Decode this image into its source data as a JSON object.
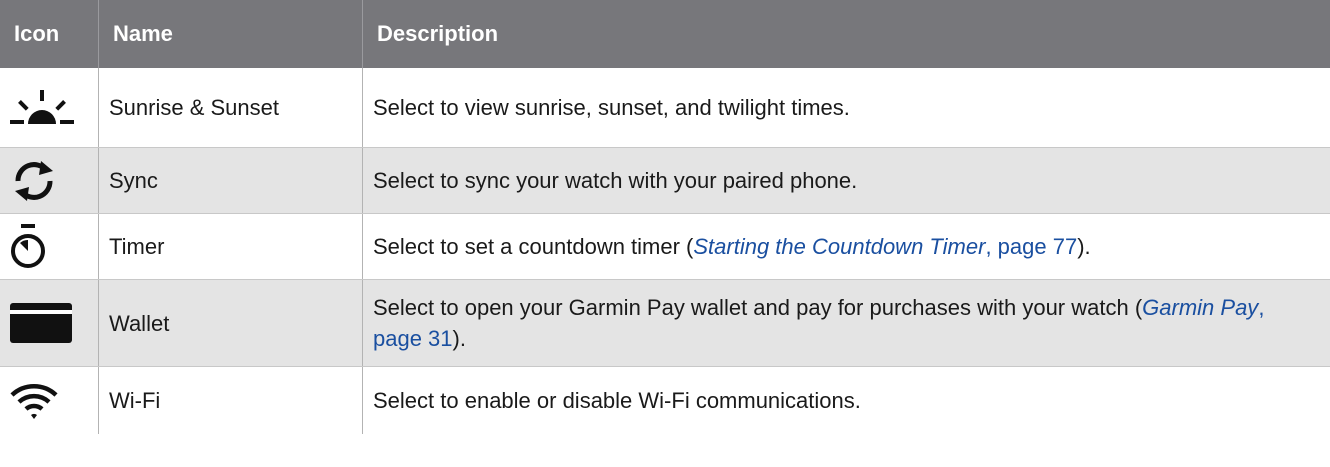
{
  "header": {
    "icon": "Icon",
    "name": "Name",
    "description": "Description"
  },
  "rows": [
    {
      "icon": "sunrise-sunset-icon",
      "name": "Sunrise & Sunset",
      "desc": "Select to view sunrise, sunset, and twilight times."
    },
    {
      "icon": "sync-icon",
      "name": "Sync",
      "desc": "Select to sync your watch with your paired phone."
    },
    {
      "icon": "timer-icon",
      "name": "Timer",
      "desc_pre": "Select to set a countdown timer (",
      "link_title": "Starting the Countdown Timer",
      "link_page": ", page 77",
      "desc_post": ")."
    },
    {
      "icon": "wallet-icon",
      "name": "Wallet",
      "desc_pre": "Select to open your Garmin Pay wallet and pay for purchases with your watch (",
      "link_title": "Garmin Pay",
      "link_page": ", page 31",
      "desc_post": ")."
    },
    {
      "icon": "wifi-icon",
      "name": "Wi-Fi",
      "desc": "Select to enable or disable Wi-Fi communications."
    }
  ],
  "colors": {
    "header_bg": "#77777b",
    "alt_row_bg": "#e4e4e4",
    "link": "#1a4fa0"
  }
}
